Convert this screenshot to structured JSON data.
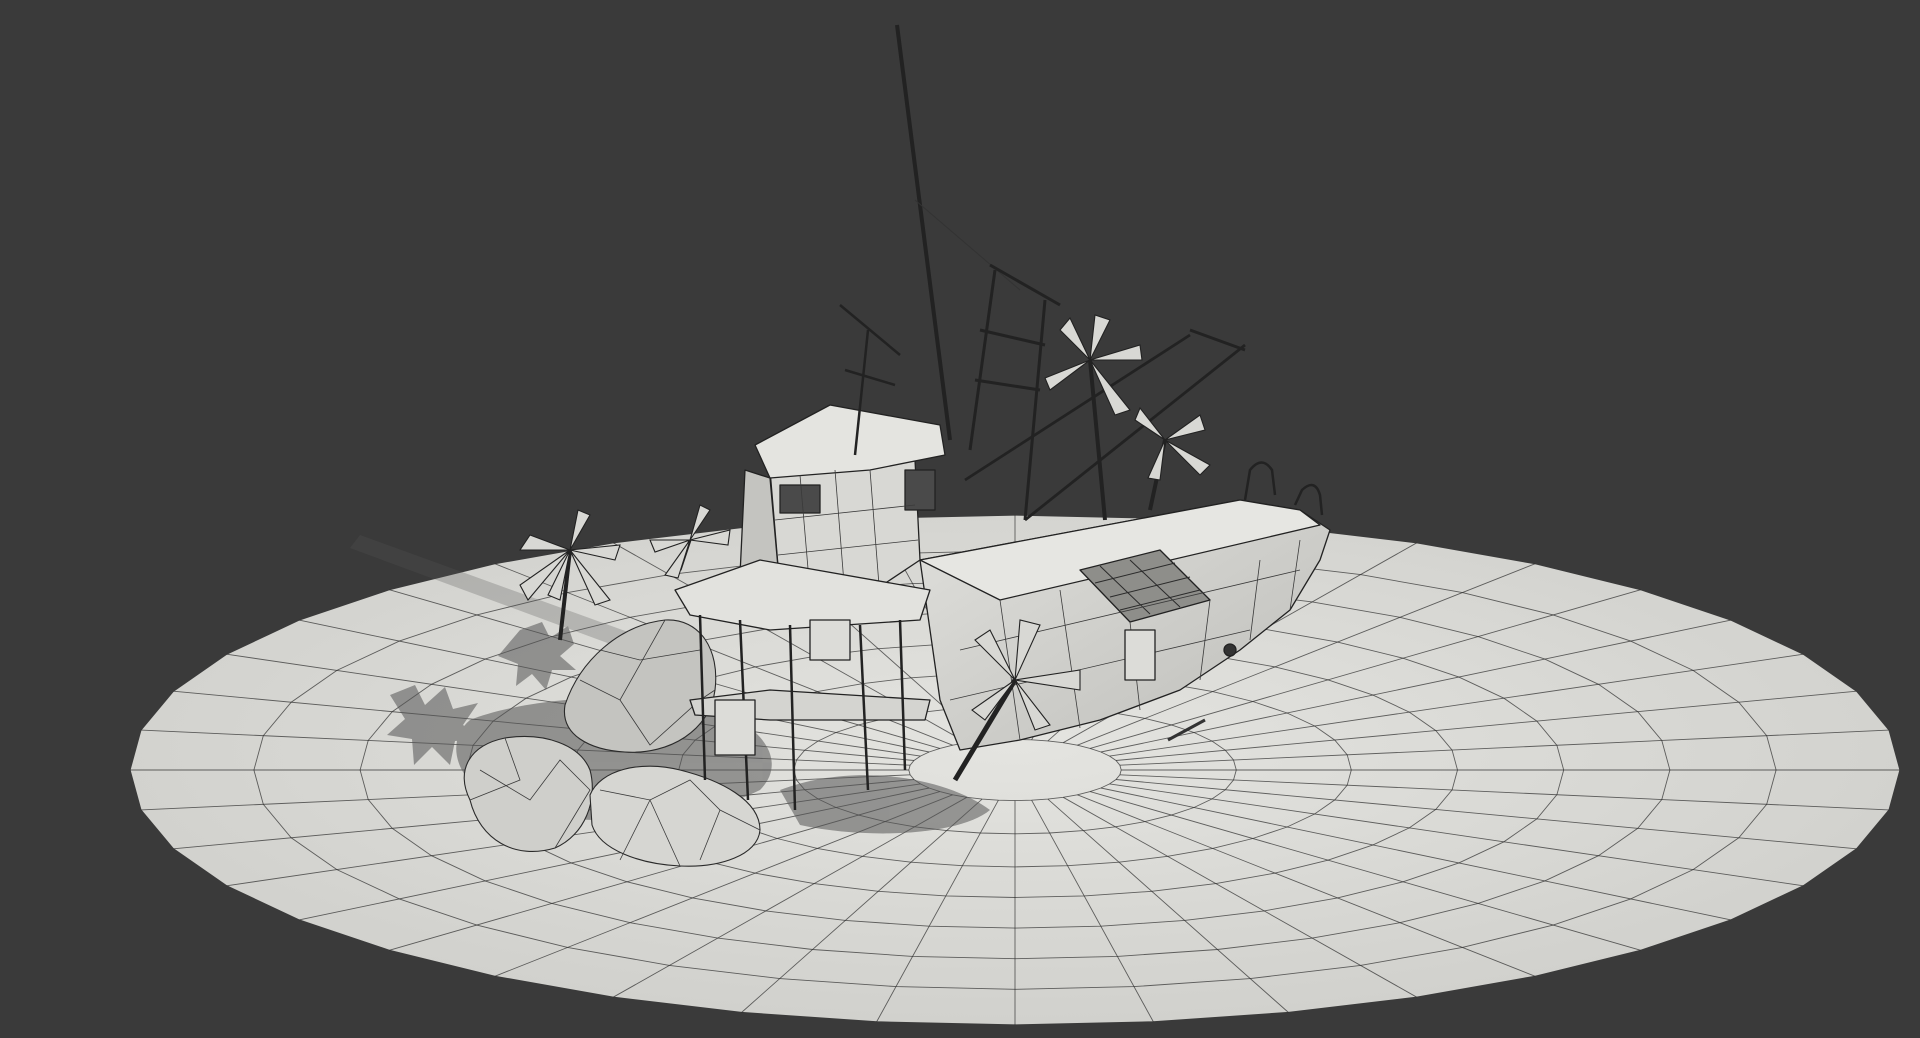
{
  "scene": {
    "background_color": "#3a3a3a",
    "ground_color": "#dcdcd8",
    "wire_color": "#2a2a2a",
    "shadow_color": "#4a4a4a",
    "hull_color": "#d2d2cf",
    "objects": [
      "ground-disc",
      "fishing-boat",
      "rock-cluster",
      "palm-tree"
    ],
    "render_style": "clay-wireframe"
  }
}
